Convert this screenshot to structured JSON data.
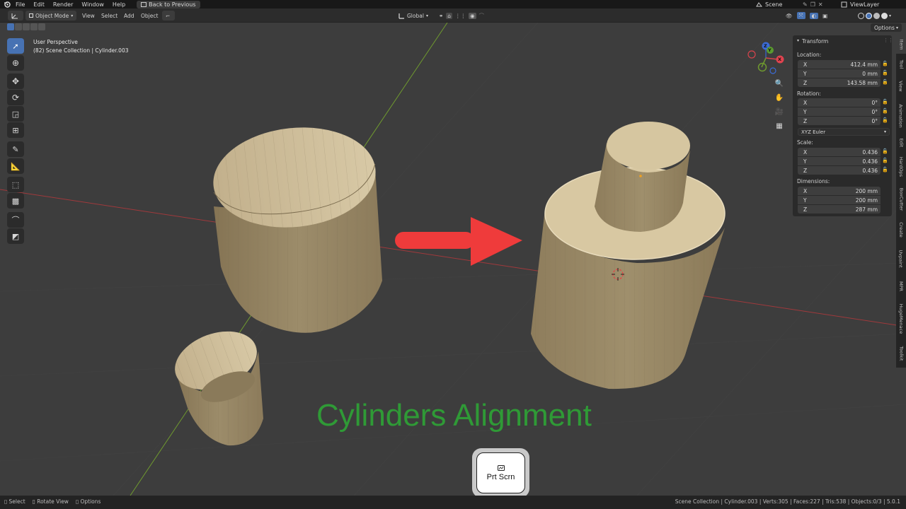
{
  "topbar": {
    "menus": [
      "File",
      "Edit",
      "Render",
      "Window",
      "Help"
    ],
    "back_label": "Back to Previous",
    "scene": "Scene",
    "view_layer": "ViewLayer"
  },
  "header": {
    "mode": "Object Mode",
    "menus": [
      "View",
      "Select",
      "Add",
      "Object"
    ],
    "orientation": "Global",
    "options_label": "Options"
  },
  "viewport": {
    "perspective": "User Perspective",
    "collection_path": "(82) Scene Collection | Cylinder.003",
    "caption": "Cylinders Alignment",
    "key_label": "Prt Scrn",
    "gizmo": {
      "x": "X",
      "y": "Y",
      "z": "Z"
    }
  },
  "transform": {
    "title": "Transform",
    "location_label": "Location:",
    "location": [
      {
        "axis": "X",
        "value": "412.4 mm"
      },
      {
        "axis": "Y",
        "value": "0 mm"
      },
      {
        "axis": "Z",
        "value": "143.58 mm"
      }
    ],
    "rotation_label": "Rotation:",
    "rotation": [
      {
        "axis": "X",
        "value": "0°"
      },
      {
        "axis": "Y",
        "value": "0°"
      },
      {
        "axis": "Z",
        "value": "0°"
      }
    ],
    "rotation_mode": "XYZ Euler",
    "scale_label": "Scale:",
    "scale": [
      {
        "axis": "X",
        "value": "0.436"
      },
      {
        "axis": "Y",
        "value": "0.436"
      },
      {
        "axis": "Z",
        "value": "0.436"
      }
    ],
    "dimensions_label": "Dimensions:",
    "dimensions": [
      {
        "axis": "X",
        "value": "200 mm"
      },
      {
        "axis": "Y",
        "value": "200 mm"
      },
      {
        "axis": "Z",
        "value": "287 mm"
      }
    ]
  },
  "sidebar_tabs": [
    "Item",
    "Tool",
    "View",
    "Animation",
    "Edit",
    "HardOps",
    "BoxCutter",
    "Create",
    "Uvpaint",
    "MPR",
    "HugeMenace",
    "Toolkit"
  ],
  "status": {
    "hints": [
      "Select",
      "Rotate View",
      "Options"
    ],
    "info": "Scene Collection | Cylinder.003 | Verts:305 | Faces:227 | Tris:538 | Objects:0/3 | 5.0.1"
  },
  "colors": {
    "axis_x": "#a0393c",
    "axis_y": "#6f9a2f",
    "arrow": "#ef3b3b",
    "caption": "#2f9a36",
    "accent": "#4772b3"
  }
}
